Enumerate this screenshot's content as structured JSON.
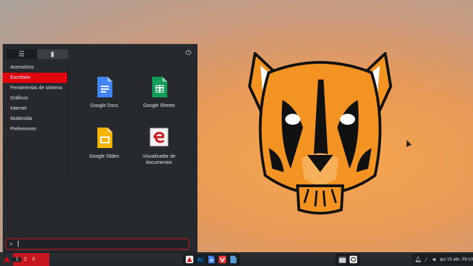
{
  "menu": {
    "tabs": [
      {
        "icon": "list-icon",
        "glyph": "☰"
      },
      {
        "icon": "bookmark-icon",
        "glyph": "▮"
      }
    ],
    "power_icon": "power-icon",
    "categories": [
      "Acessórios",
      "Escritório",
      "Ferramentas de sistema",
      "Gráficos",
      "Internet",
      "Multimídia",
      "Preferences"
    ],
    "selected_category": "Escritório",
    "apps": [
      {
        "label": "Google Docs",
        "icon": "google-docs-icon"
      },
      {
        "label": "Google Sheets",
        "icon": "google-sheets-icon"
      },
      {
        "label": "Google Slides",
        "icon": "google-slides-icon"
      },
      {
        "label": "Visualizador de documentos",
        "icon": "document-viewer-icon"
      }
    ],
    "search": {
      "placeholder": "",
      "value": ""
    }
  },
  "taskbar": {
    "workspaces": [
      "1",
      "2",
      "3"
    ],
    "active_workspace": "1",
    "launchers": [
      "app-launcher-icon",
      "photoshop-icon",
      "google-docs-icon",
      "vivaldi-icon",
      "file-manager-icon"
    ],
    "window_buttons": [
      "window-icon",
      "terminal-icon"
    ],
    "tray_icons": [
      "notifications-icon",
      "network-icon",
      "volume-icon"
    ],
    "clock": "qui 15 abr, 09:10"
  },
  "colors": {
    "accent": "#e1040d",
    "menu_bg": "#262a2f",
    "tiger_orange": "#f39322"
  }
}
